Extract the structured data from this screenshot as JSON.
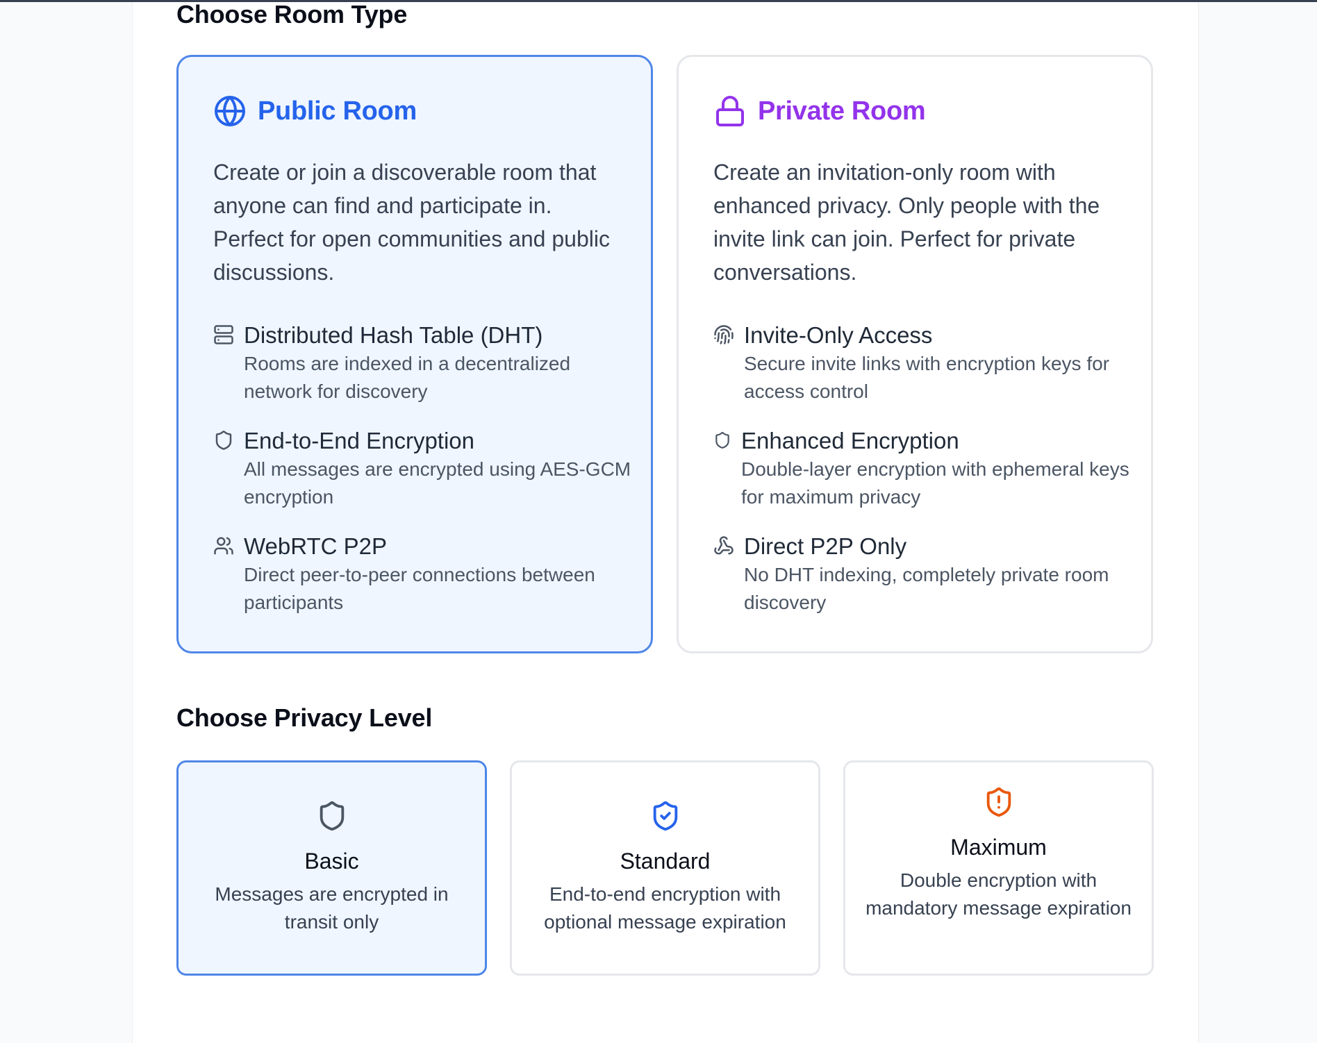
{
  "sections": {
    "room_type_title": "Choose Room Type",
    "privacy_title": "Choose Privacy Level"
  },
  "colors": {
    "public_accent": "#2563eb",
    "private_accent": "#9333ea",
    "selected_border": "#4f86e8",
    "selected_bg": "#eff6ff",
    "standard_icon": "#2563eb",
    "maximum_icon": "#ea580c"
  },
  "room_types": {
    "public": {
      "icon": "globe-icon",
      "title": "Public Room",
      "description": "Create or join a discoverable room that anyone can find and participate in. Perfect for open communities and public discussions.",
      "selected": true,
      "features": [
        {
          "icon": "server-icon",
          "title": "Distributed Hash Table (DHT)",
          "description": "Rooms are indexed in a decentralized network for discovery"
        },
        {
          "icon": "shield-icon",
          "title": "End-to-End Encryption",
          "description": "All messages are encrypted using AES-GCM encryption"
        },
        {
          "icon": "users-icon",
          "title": "WebRTC P2P",
          "description": "Direct peer-to-peer connections between participants"
        }
      ]
    },
    "private": {
      "icon": "lock-icon",
      "title": "Private Room",
      "description": "Create an invitation-only room with enhanced privacy. Only people with the invite link can join. Perfect for private conversations.",
      "selected": false,
      "features": [
        {
          "icon": "fingerprint-icon",
          "title": "Invite-Only Access",
          "description": "Secure invite links with encryption keys for access control"
        },
        {
          "icon": "shield-icon",
          "title": "Enhanced Encryption",
          "description": "Double-layer encryption with ephemeral keys for maximum privacy"
        },
        {
          "icon": "webhook-icon",
          "title": "Direct P2P Only",
          "description": "No DHT indexing, completely private room discovery"
        }
      ]
    }
  },
  "privacy_levels": [
    {
      "icon": "shield-icon",
      "title": "Basic",
      "description": "Messages are encrypted in transit only",
      "selected": true
    },
    {
      "icon": "shield-check-icon",
      "title": "Standard",
      "description": "End-to-end encryption with optional message expiration",
      "selected": false
    },
    {
      "icon": "shield-alert-icon",
      "title": "Maximum",
      "description": "Double encryption with mandatory message expiration",
      "selected": false
    }
  ]
}
